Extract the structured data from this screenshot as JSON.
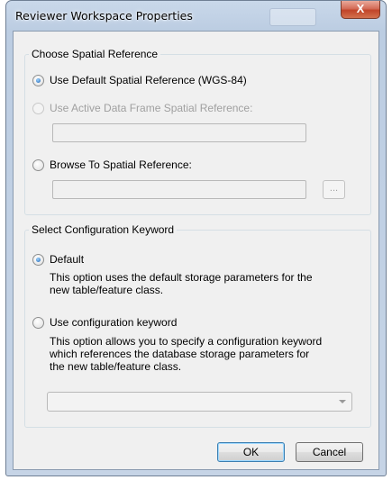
{
  "window": {
    "title": "Reviewer Workspace Properties",
    "close_glyph": "X",
    "close_icon": "close-icon"
  },
  "spatial_reference": {
    "legend": "Choose Spatial Reference",
    "option_default": "Use Default Spatial Reference (WGS-84)",
    "option_active": "Use Active Data Frame Spatial Reference:",
    "option_browse": "Browse To Spatial Reference:",
    "active_value": "",
    "browse_value": "",
    "browse_button_label": "...",
    "selected": "default"
  },
  "config_keyword": {
    "legend": "Select Configuration Keyword",
    "option_default": "Default",
    "option_default_desc_line1": "This option uses the default storage parameters for the",
    "option_default_desc_line2": "new  table/feature class.",
    "option_keyword": "Use configuration keyword",
    "option_keyword_desc_line1": "This option allows you to specify a configuration keyword",
    "option_keyword_desc_line2": "which references the database storage parameters for",
    "option_keyword_desc_line3": "the new table/feature class.",
    "keyword_value": "",
    "selected": "default"
  },
  "buttons": {
    "ok": "OK",
    "cancel": "Cancel"
  }
}
